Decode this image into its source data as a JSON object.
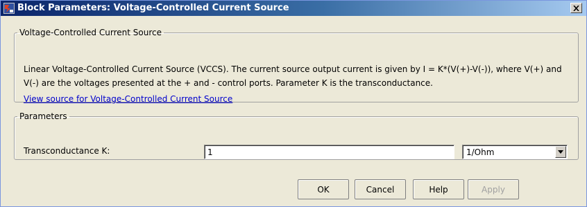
{
  "window": {
    "title": "Block Parameters: Voltage-Controlled Current Source"
  },
  "description_group": {
    "legend": "Voltage-Controlled Current Source",
    "text": "Linear Voltage-Controlled Current Source (VCCS). The current source output current is given by I = K*(V(+)-V(-)), where V(+) and V(-) are the voltages presented at the + and - control ports. Parameter K is the transconductance.",
    "link": "View source for Voltage-Controlled Current Source"
  },
  "parameters_group": {
    "legend": "Parameters",
    "transconductance_label": "Transconductance K:",
    "transconductance_value": "1",
    "unit_selected": "1/Ohm"
  },
  "buttons": {
    "ok": "OK",
    "cancel": "Cancel",
    "help": "Help",
    "apply": "Apply"
  },
  "icons": {
    "app": "simulink-block-icon",
    "close": "close-icon",
    "dropdown": "chevron-down-icon"
  }
}
